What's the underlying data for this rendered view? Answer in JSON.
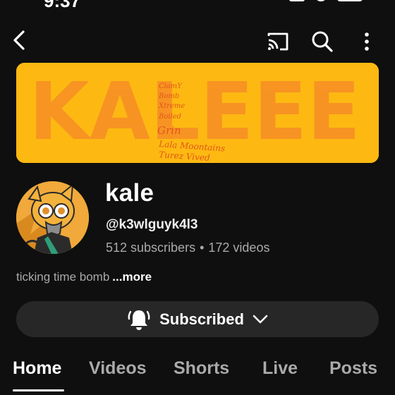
{
  "status_bar": {
    "time": "9:37"
  },
  "top_bar": {
    "back_icon": "chevron-left-icon",
    "cast_icon": "cast-icon",
    "search_icon": "search-icon",
    "more_icon": "more-vert-icon"
  },
  "banner": {
    "title_art": "KALEEE",
    "names": [
      "ClamY",
      "Bomb",
      "Xtreme",
      "Boiled",
      "Grin",
      "Lala Moontains",
      "Turez Vived"
    ],
    "background_color": "#fdb912",
    "text_color": "#f79224"
  },
  "channel": {
    "name": "kale",
    "handle": "@k3wlguyk4l3",
    "subscribers": "512 subscribers",
    "separator": "•",
    "videos": "172 videos",
    "description": "ticking time bomb",
    "more_label": "...more"
  },
  "subscribe": {
    "label": "Subscribed",
    "bell_icon": "bell-icon",
    "chevron_icon": "chevron-down-icon"
  },
  "tabs": [
    {
      "label": "Home",
      "active": true
    },
    {
      "label": "Videos",
      "active": false
    },
    {
      "label": "Shorts",
      "active": false
    },
    {
      "label": "Live",
      "active": false
    },
    {
      "label": "Posts",
      "active": false
    }
  ]
}
